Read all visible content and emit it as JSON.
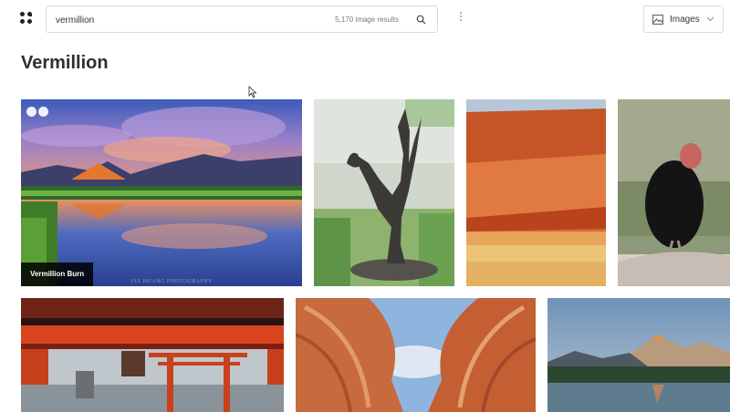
{
  "header": {
    "logo_icon": "dots-grid-logo-icon",
    "search": {
      "value": "vermillion",
      "placeholder": "",
      "results_count": "5,170 image results",
      "icon": "search-icon"
    },
    "more_icon": "vertical-dots-icon",
    "type_dropdown": {
      "label": "Images",
      "icon": "image-icon",
      "chevron": "chevron-down-icon"
    }
  },
  "page": {
    "title": "Vermillion"
  },
  "tiles": [
    {
      "caption": "Vermillion Burn",
      "watermark": "JAY HUANG PHOTOGRAPHY"
    }
  ]
}
